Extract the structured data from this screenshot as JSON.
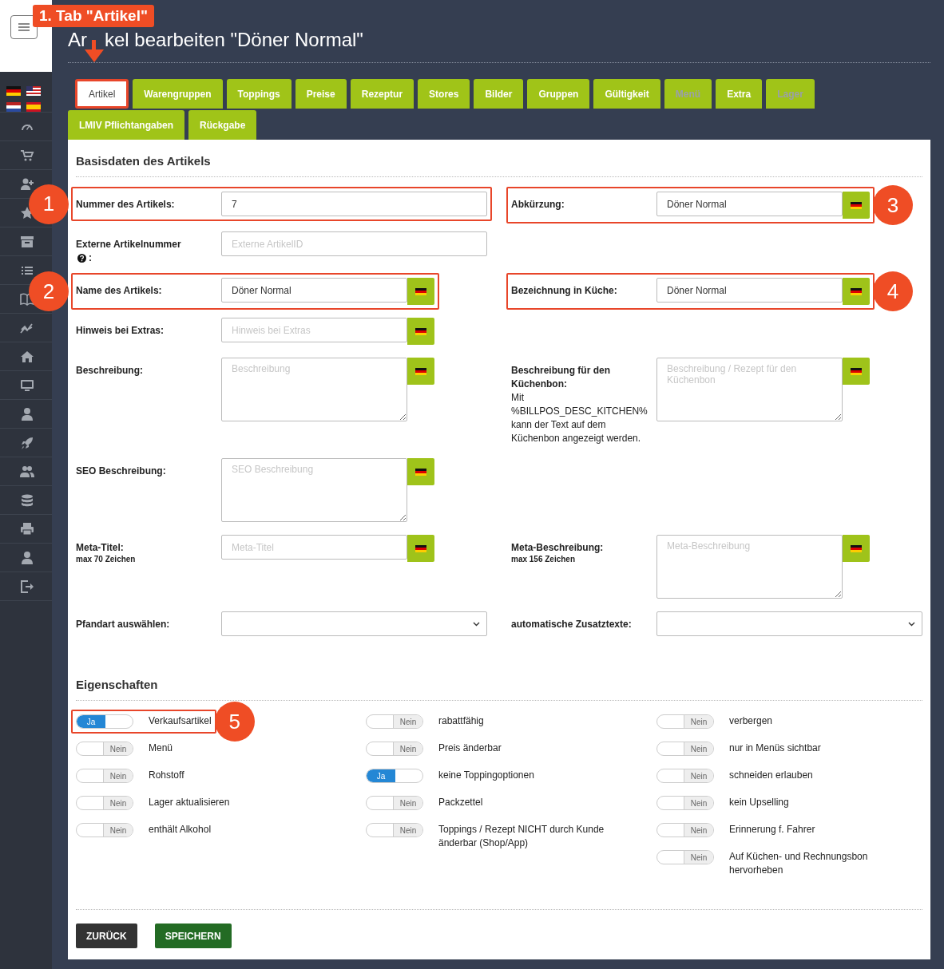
{
  "title": {
    "start": "Ar",
    "rest": "kel bearbeiten \"Döner Normal\""
  },
  "callout": {
    "text": "1. Tab \"Artikel\""
  },
  "tabs": [
    {
      "label": "Artikel",
      "selected": true,
      "disabled": false,
      "highlighted": true
    },
    {
      "label": "Warengruppen",
      "selected": false,
      "disabled": false,
      "highlighted": false
    },
    {
      "label": "Toppings",
      "selected": false,
      "disabled": false,
      "highlighted": false
    },
    {
      "label": "Preise",
      "selected": false,
      "disabled": false,
      "highlighted": false
    },
    {
      "label": "Rezeptur",
      "selected": false,
      "disabled": false,
      "highlighted": false
    },
    {
      "label": "Stores",
      "selected": false,
      "disabled": false,
      "highlighted": false
    },
    {
      "label": "Bilder",
      "selected": false,
      "disabled": false,
      "highlighted": false
    },
    {
      "label": "Gruppen",
      "selected": false,
      "disabled": false,
      "highlighted": false
    },
    {
      "label": "Gültigkeit",
      "selected": false,
      "disabled": false,
      "highlighted": false
    },
    {
      "label": "Menü",
      "selected": false,
      "disabled": true,
      "highlighted": false
    },
    {
      "label": "Extra",
      "selected": false,
      "disabled": false,
      "highlighted": false
    },
    {
      "label": "Lager",
      "selected": false,
      "disabled": true,
      "highlighted": false
    },
    {
      "label": "LMIV Pflichtangaben",
      "selected": false,
      "disabled": false,
      "highlighted": false
    },
    {
      "label": "Rückgabe",
      "selected": false,
      "disabled": false,
      "highlighted": false
    }
  ],
  "basisdaten": {
    "heading": "Basisdaten des Artikels",
    "rows": [
      {
        "left": {
          "label": "Nummer des Artikels:",
          "kind": "input",
          "value": "7",
          "flag": false,
          "marker": "1"
        },
        "right": {
          "label": "Abkürzung:",
          "kind": "input",
          "value": "Döner Normal",
          "flag": true,
          "marker": "3"
        }
      },
      {
        "left": {
          "label": "Externe Artikelnummer",
          "help": true,
          "label_tail": ":",
          "kind": "input",
          "placeholder": "Externe ArtikelID",
          "flag": false
        }
      },
      {
        "left": {
          "label": "Name des Artikels:",
          "kind": "input",
          "value": "Döner Normal",
          "flag": true,
          "marker": "2"
        },
        "right": {
          "label": "Bezeichnung in Küche:",
          "kind": "input",
          "value": "Döner Normal",
          "flag": true,
          "marker": "4"
        }
      },
      {
        "left": {
          "label": "Hinweis bei Extras:",
          "kind": "input",
          "placeholder": "Hinweis bei Extras",
          "flag": true
        }
      },
      {
        "left": {
          "label": "Beschreibung:",
          "kind": "textarea",
          "placeholder": "Beschreibung",
          "flag": true
        },
        "right": {
          "label": "Beschreibung für den Küchenbon:",
          "note": "Mit %BILLPOS_DESC_KITCHEN% kann der Text auf dem Küchenbon angezeigt werden.",
          "kind": "textarea",
          "placeholder": "Beschreibung / Rezept für den Küchenbon",
          "flag": true
        }
      },
      {
        "left": {
          "label": "SEO Beschreibung:",
          "kind": "textarea",
          "placeholder": "SEO Beschreibung",
          "flag": true
        }
      },
      {
        "left": {
          "label": "Meta-Titel:",
          "sub": "max 70 Zeichen",
          "kind": "input",
          "placeholder": "Meta-Titel",
          "flag": true
        },
        "right": {
          "label": "Meta-Beschreibung:",
          "sub": "max 156 Zeichen",
          "kind": "textarea",
          "placeholder": "Meta-Beschreibung",
          "flag": true
        }
      },
      {
        "left": {
          "label": "Pfandart auswählen:",
          "kind": "select",
          "flag": false
        },
        "right": {
          "label": "automatische Zusatztexte:",
          "kind": "select",
          "flag": false
        }
      }
    ]
  },
  "properties": {
    "heading": "Eigenschaften",
    "columns": [
      [
        {
          "label": "Verkaufsartikel",
          "on": true,
          "switch_text": "Ja",
          "marker": "5"
        },
        {
          "label": "Menü",
          "on": false,
          "switch_text": "Nein"
        },
        {
          "label": "Rohstoff",
          "on": false,
          "switch_text": "Nein"
        },
        {
          "label": "Lager aktualisieren",
          "on": false,
          "switch_text": "Nein"
        },
        {
          "label": "enthält Alkohol",
          "on": false,
          "switch_text": "Nein"
        }
      ],
      [
        {
          "label": "rabattfähig",
          "on": false,
          "switch_text": "Nein"
        },
        {
          "label": "Preis änderbar",
          "on": false,
          "switch_text": "Nein"
        },
        {
          "label": "keine Toppingoptionen",
          "on": true,
          "switch_text": "Ja"
        },
        {
          "label": "Packzettel",
          "on": false,
          "switch_text": "Nein"
        },
        {
          "label": "Toppings / Rezept NICHT durch Kunde änderbar (Shop/App)",
          "on": false,
          "switch_text": "Nein"
        }
      ],
      [
        {
          "label": "verbergen",
          "on": false,
          "switch_text": "Nein"
        },
        {
          "label": "nur in Menüs sichtbar",
          "on": false,
          "switch_text": "Nein"
        },
        {
          "label": "schneiden erlauben",
          "on": false,
          "switch_text": "Nein"
        },
        {
          "label": "kein Upselling",
          "on": false,
          "switch_text": "Nein"
        },
        {
          "label": "Erinnerung f. Fahrer",
          "on": false,
          "switch_text": "Nein"
        },
        {
          "label": "Auf Küchen- und Rechnungsbon hervorheben",
          "on": false,
          "switch_text": "Nein"
        }
      ]
    ]
  },
  "buttons": [
    {
      "label": "ZURÜCK",
      "kind": "back"
    },
    {
      "label": "SPEICHERN",
      "kind": "save"
    }
  ]
}
